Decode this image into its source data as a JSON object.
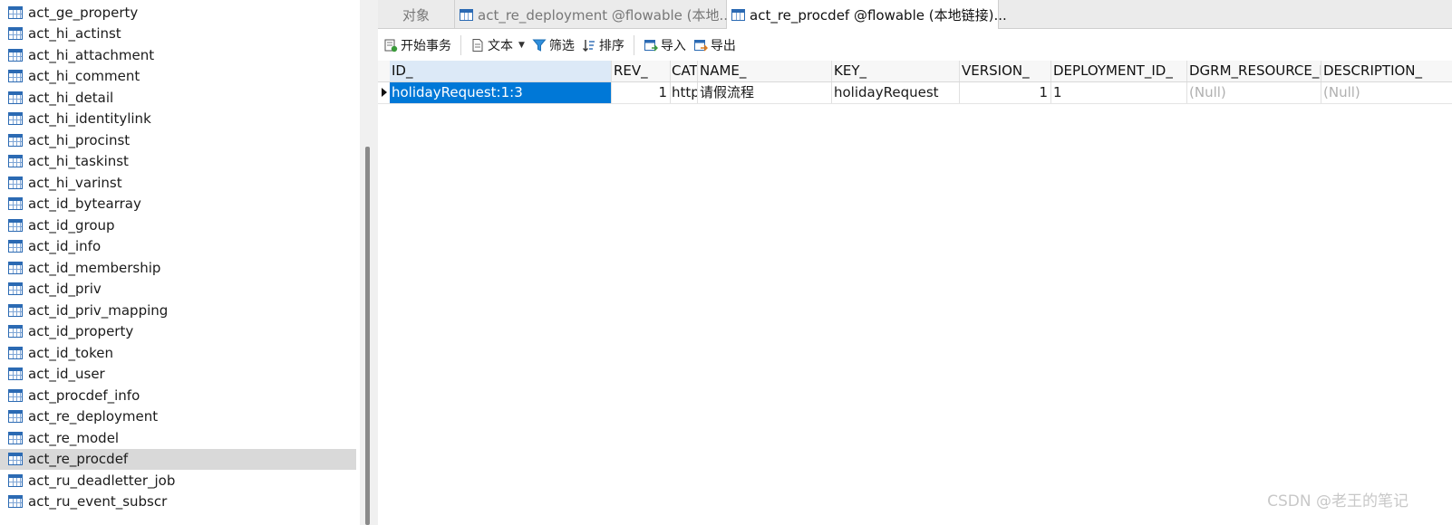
{
  "sidebar": {
    "items": [
      {
        "label": "act_ge_property",
        "selected": false
      },
      {
        "label": "act_hi_actinst",
        "selected": false
      },
      {
        "label": "act_hi_attachment",
        "selected": false
      },
      {
        "label": "act_hi_comment",
        "selected": false
      },
      {
        "label": "act_hi_detail",
        "selected": false
      },
      {
        "label": "act_hi_identitylink",
        "selected": false
      },
      {
        "label": "act_hi_procinst",
        "selected": false
      },
      {
        "label": "act_hi_taskinst",
        "selected": false
      },
      {
        "label": "act_hi_varinst",
        "selected": false
      },
      {
        "label": "act_id_bytearray",
        "selected": false
      },
      {
        "label": "act_id_group",
        "selected": false
      },
      {
        "label": "act_id_info",
        "selected": false
      },
      {
        "label": "act_id_membership",
        "selected": false
      },
      {
        "label": "act_id_priv",
        "selected": false
      },
      {
        "label": "act_id_priv_mapping",
        "selected": false
      },
      {
        "label": "act_id_property",
        "selected": false
      },
      {
        "label": "act_id_token",
        "selected": false
      },
      {
        "label": "act_id_user",
        "selected": false
      },
      {
        "label": "act_procdef_info",
        "selected": false
      },
      {
        "label": "act_re_deployment",
        "selected": false
      },
      {
        "label": "act_re_model",
        "selected": false
      },
      {
        "label": "act_re_procdef",
        "selected": true
      },
      {
        "label": "act_ru_deadletter_job",
        "selected": false
      },
      {
        "label": "act_ru_event_subscr",
        "selected": false
      }
    ]
  },
  "tabs": [
    {
      "label": "对象",
      "icon": "none",
      "active": false
    },
    {
      "label": "act_re_deployment @flowable (本地...",
      "icon": "table-icon",
      "active": false
    },
    {
      "label": "act_re_procdef @flowable (本地链接)...",
      "icon": "table-icon",
      "active": true
    }
  ],
  "toolbar": {
    "begin_transaction": "开始事务",
    "text": "文本",
    "filter": "筛选",
    "sort": "排序",
    "import": "导入",
    "export": "导出"
  },
  "grid": {
    "columns": [
      "ID_",
      "REV_",
      "CATEGORY_",
      "NAME_",
      "KEY_",
      "VERSION_",
      "DEPLOYMENT_ID_",
      "DGRM_RESOURCE_NAME_",
      "DESCRIPTION_"
    ],
    "rows": [
      [
        "holidayRequest:1:3",
        "1",
        "http://www.flowable.org/processdef",
        "请假流程",
        "holidayRequest",
        "1",
        "1",
        "(Null)",
        "(Null)"
      ]
    ]
  },
  "watermark": "CSDN @老王的笔记",
  "colors": {
    "selection": "#0078d7",
    "sidebar_selected": "#d9d9d9",
    "table_icon": "#2b6ab3",
    "null_text": "#b0b0b0"
  }
}
